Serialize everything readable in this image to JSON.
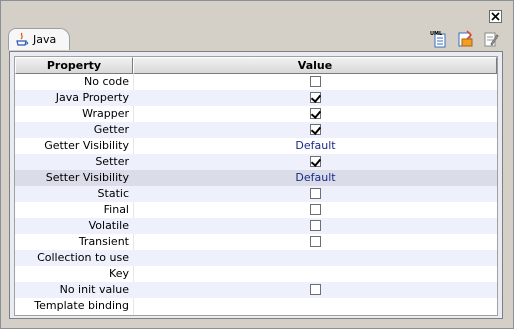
{
  "tab": {
    "label": "Java"
  },
  "table": {
    "columns": [
      "Property",
      "Value"
    ],
    "rows": [
      {
        "property": "No code",
        "type": "checkbox",
        "checked": false,
        "value": ""
      },
      {
        "property": "Java Property",
        "type": "checkbox",
        "checked": true,
        "value": ""
      },
      {
        "property": "Wrapper",
        "type": "checkbox",
        "checked": true,
        "value": ""
      },
      {
        "property": "Getter",
        "type": "checkbox",
        "checked": true,
        "value": ""
      },
      {
        "property": "Getter Visibility",
        "type": "text",
        "checked": false,
        "value": "Default"
      },
      {
        "property": "Setter",
        "type": "checkbox",
        "checked": true,
        "value": ""
      },
      {
        "property": "Setter Visibility",
        "type": "text",
        "checked": false,
        "value": "Default"
      },
      {
        "property": "Static",
        "type": "checkbox",
        "checked": false,
        "value": ""
      },
      {
        "property": "Final",
        "type": "checkbox",
        "checked": false,
        "value": ""
      },
      {
        "property": "Volatile",
        "type": "checkbox",
        "checked": false,
        "value": ""
      },
      {
        "property": "Transient",
        "type": "checkbox",
        "checked": false,
        "value": ""
      },
      {
        "property": "Collection to use",
        "type": "empty",
        "checked": false,
        "value": ""
      },
      {
        "property": "Key",
        "type": "empty",
        "checked": false,
        "value": ""
      },
      {
        "property": "No init value",
        "type": "checkbox",
        "checked": false,
        "value": ""
      },
      {
        "property": "Template binding",
        "type": "empty",
        "checked": false,
        "value": ""
      }
    ]
  },
  "toolbar": {
    "icons": [
      "uml-document-icon",
      "export-icon",
      "edit-document-icon"
    ]
  },
  "colors": {
    "frame_bg": "#d4d0c8",
    "row_alt": "#eef0fb",
    "row_selected": "#dadce8",
    "value_text": "#1a2a8a"
  }
}
